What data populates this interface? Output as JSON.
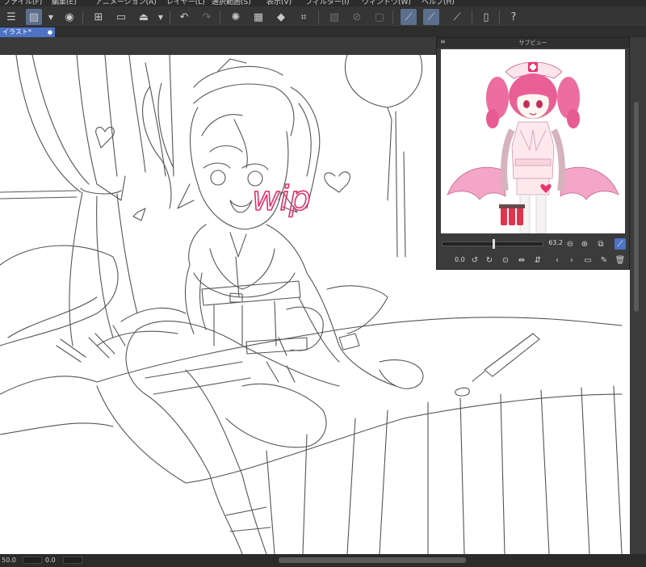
{
  "menu": {
    "items": [
      "ファイル(F)",
      "編集(E)",
      "アニメーション(A)",
      "レイヤー(L)",
      "選択範囲(S)",
      "表示(V)",
      "フィルター(I)",
      "ウィンドウ(W)",
      "ヘルプ(H)"
    ]
  },
  "toolbar": {
    "icons": [
      "menu-icon",
      "canvas-icon",
      "camera-icon",
      "new-file-icon",
      "open-folder-icon",
      "save-icon",
      "undo-icon",
      "redo-icon",
      "loading-icon",
      "transform-icon",
      "fill-icon",
      "crop-icon",
      "select-all-icon",
      "deselect-icon",
      "mask-icon",
      "pen-icon",
      "pen-alt-icon",
      "pencil-line-icon",
      "tablet-icon",
      "help-icon"
    ]
  },
  "document": {
    "tab_label": "イラスト*",
    "close_glyph": "●"
  },
  "canvas": {
    "overlay_text": "wip",
    "accent_color": "#e0306a"
  },
  "subview": {
    "title": "サブビュー",
    "menu_glyph": "≡",
    "zoom_value": "63.2",
    "rotation_value": "0.0"
  },
  "status": {
    "zoom": "50.0",
    "angle": "0.0"
  },
  "colors": {
    "accent": "#4e73c4",
    "active_tool": "#5b6f8e",
    "pink": "#e8679a"
  }
}
